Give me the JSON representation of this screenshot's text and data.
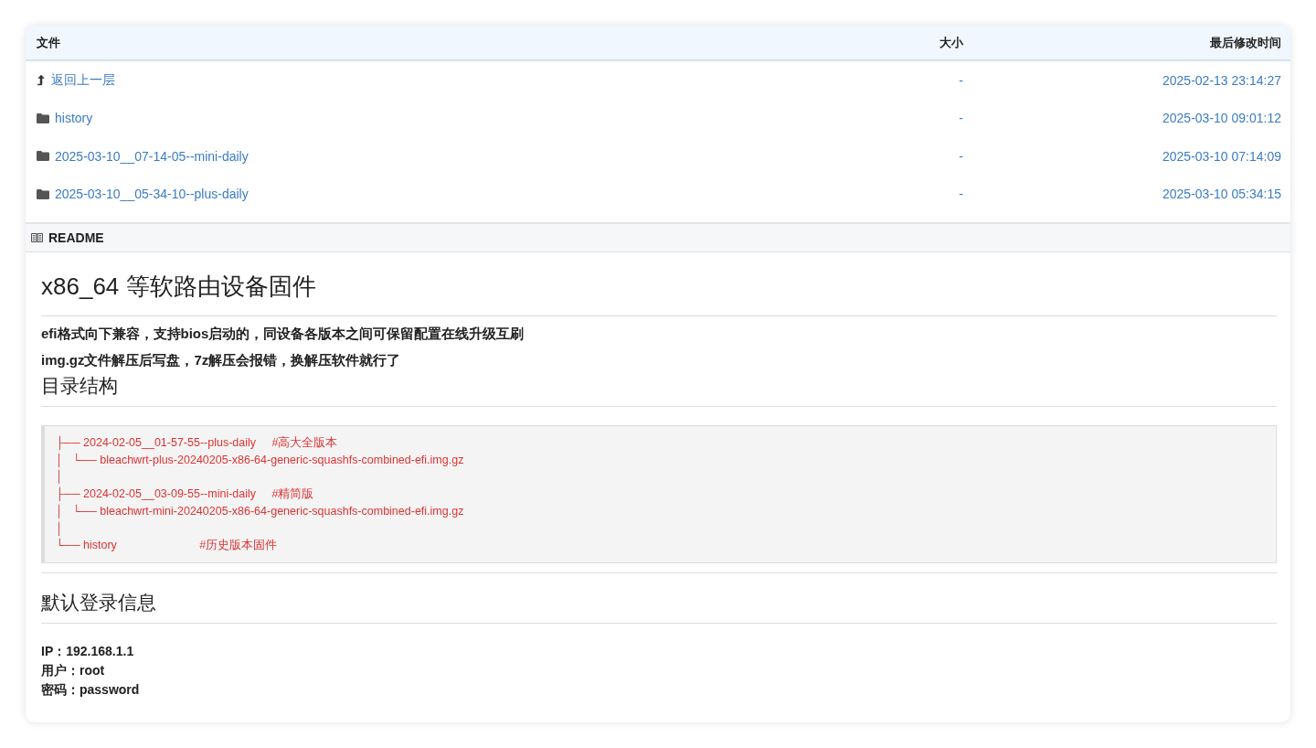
{
  "table": {
    "columns": [
      "文件",
      "大小",
      "最后修改时间"
    ],
    "rows": [
      {
        "kind": "parent",
        "name": "返回上一层",
        "size": "-",
        "modified": "2025-02-13 23:14:27"
      },
      {
        "kind": "folder",
        "name": "history",
        "size": "-",
        "modified": "2025-03-10 09:01:12"
      },
      {
        "kind": "folder",
        "name": "2025-03-10__07-14-05--mini-daily",
        "size": "-",
        "modified": "2025-03-10 07:14:09"
      },
      {
        "kind": "folder",
        "name": "2025-03-10__05-34-10--plus-daily",
        "size": "-",
        "modified": "2025-03-10 05:34:15"
      }
    ]
  },
  "readme": {
    "title": "README",
    "heading": "x86_64 等软路由设备固件",
    "notes": [
      "efi格式向下兼容，支持bios启动的，同设备各版本之间可保留配置在线升级互刷",
      "img.gz文件解压后写盘，7z解压会报错，换解压软件就行了"
    ],
    "tree_heading": "目录结构",
    "tree_lines": [
      "├── 2024-02-05__01-57-55--plus-daily     #高大全版本",
      "│   └── bleachwrt-plus-20240205-x86-64-generic-squashfs-combined-efi.img.gz",
      "│",
      "├── 2024-02-05__03-09-55--mini-daily     #精简版",
      "│   └── bleachwrt-mini-20240205-x86-64-generic-squashfs-combined-efi.img.gz",
      "│",
      "└── history                          #历史版本固件"
    ],
    "login_heading": "默认登录信息",
    "login_lines": [
      "IP：192.168.1.1",
      "用户：root",
      "密码：password"
    ]
  }
}
